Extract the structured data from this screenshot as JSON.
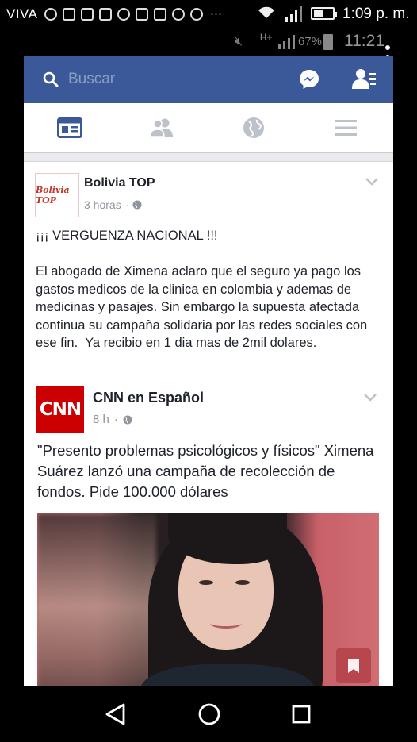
{
  "status_bar": {
    "carrier": "VIVA",
    "time": "1:09 p. m.",
    "notification_overflow": "···",
    "inner_battery": "67%",
    "inner_time": "11:21",
    "inner_network": "H+",
    "battery_level": 0.55
  },
  "header": {
    "search_placeholder": "Buscar"
  },
  "tabs": [
    {
      "icon": "news-feed-icon",
      "active": true
    },
    {
      "icon": "friends-icon",
      "active": false
    },
    {
      "icon": "globe-icon",
      "active": false
    },
    {
      "icon": "menu-icon",
      "active": false
    }
  ],
  "post": {
    "avatar_text": "Bolivia TOP",
    "author": "Bolivia TOP",
    "time": "3 horas",
    "separator": "·",
    "text": "¡¡¡ VERGUENZA NACIONAL !!!\n\nEl abogado de Ximena aclaro que el seguro ya pago los gastos medicos de la clinica en colombia y ademas de medicinas y pasajes. Sin embargo la supuesta afectada continua su campaña solidaria por las redes sociales con ese fin.  Ya recibio en 1 dia mas de 2mil dolares."
  },
  "shared": {
    "avatar_text": "CNN",
    "author": "CNN en Español",
    "time": "8 h",
    "separator": "·",
    "text": "\"Presento problemas psicológicos y físicos\" Ximena Suárez lanzó una campaña de recolección de fondos. Pide 100.000 dólares"
  },
  "colors": {
    "facebook_blue": "#3b5998",
    "cnn_red": "#cc0000",
    "tab_active": "#3b5998",
    "tab_inactive": "#bdc1c9"
  }
}
